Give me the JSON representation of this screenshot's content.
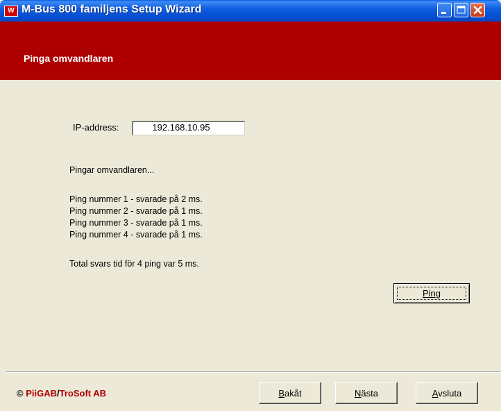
{
  "window": {
    "title": "M-Bus 800 familjens Setup Wizard",
    "app_icon_letter": "W"
  },
  "header": {
    "title": "Pinga omvandlaren"
  },
  "form": {
    "ip_label": "IP-address:",
    "ip_value": "192.168.10.95"
  },
  "messages": {
    "pinging": "Pingar omvandlaren...",
    "ping_results": [
      "Ping nummer 1 - svarade på 2 ms.",
      "Ping nummer 2 - svarade på 1 ms.",
      "Ping nummer 3 - svarade på 1 ms.",
      "Ping nummer 4 - svarade på 1 ms."
    ],
    "total": "Total svars tid för 4 ping var 5 ms."
  },
  "buttons": {
    "ping": "Ping",
    "back_first": "B",
    "back_rest": "akåt",
    "next_first": "N",
    "next_rest": "ästa",
    "exit_first": "A",
    "exit_rest": "vsluta"
  },
  "footer": {
    "copyright_symbol": "©",
    "brand1": "PiiGAB",
    "separator": "/",
    "brand2": "TroSoft AB"
  },
  "colors": {
    "titlebar": "#0651d6",
    "header_band": "#ae0000",
    "panel": "#ece9d8",
    "brand_red": "#b00000"
  }
}
